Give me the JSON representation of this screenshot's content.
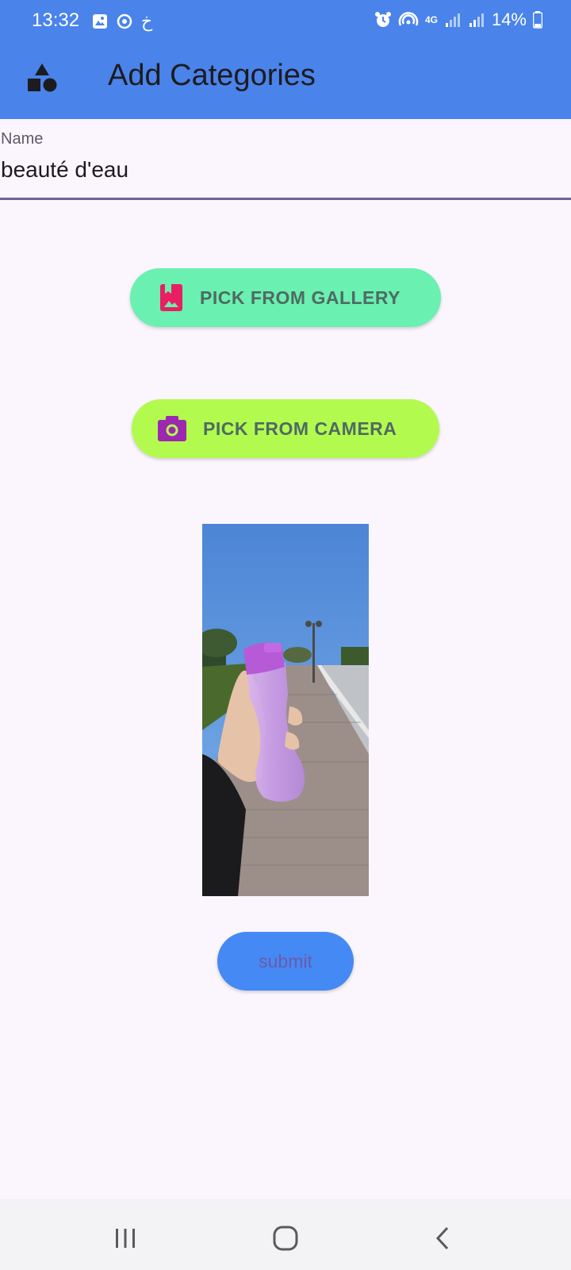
{
  "status_bar": {
    "time": "13:32",
    "arabic_glyph": "خ",
    "network": "4G",
    "battery": "14%"
  },
  "app_bar": {
    "title": "Add Categories",
    "icon": "shapes-icon"
  },
  "form": {
    "name_label": "Name",
    "name_value": "beauté d'eau"
  },
  "buttons": {
    "gallery": "PICK FROM GALLERY",
    "camera": "PICK FROM CAMERA",
    "submit": "submit"
  },
  "icons": {
    "gallery": "photo-library-icon",
    "camera": "camera-icon"
  },
  "colors": {
    "app_bar": "#4a83ea",
    "gallery_button": "#6af0b0",
    "camera_button": "#b3fa4f",
    "submit_button": "#4589f5",
    "gallery_icon": "#e91e63",
    "camera_icon": "#9c27b0",
    "background": "#fbf6fd"
  },
  "image": {
    "description_icon": "selected-photo"
  }
}
